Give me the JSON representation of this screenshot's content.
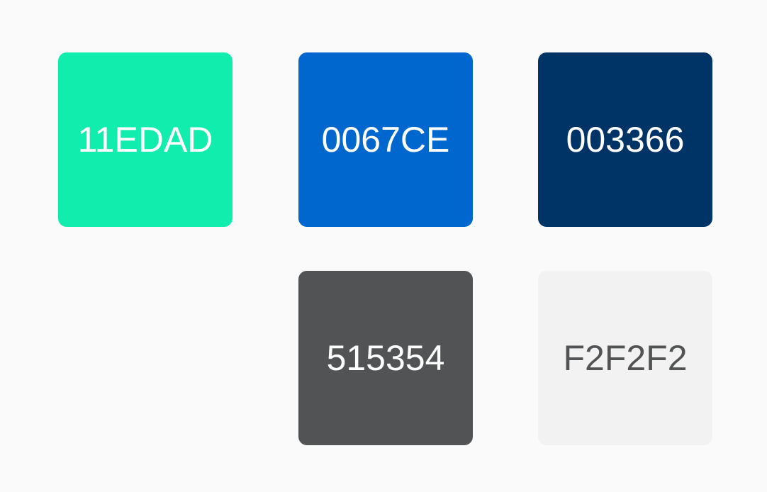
{
  "swatches": [
    {
      "label": "11EDAD",
      "color": "#11EDAD",
      "text_color": "#ffffff"
    },
    {
      "label": "0067CE",
      "color": "#0067CE",
      "text_color": "#ffffff"
    },
    {
      "label": "003366",
      "color": "#003366",
      "text_color": "#ffffff"
    },
    {
      "label": "515354",
      "color": "#515354",
      "text_color": "#ffffff"
    },
    {
      "label": "F2F2F2",
      "color": "#F2F2F2",
      "text_color": "#515354"
    }
  ]
}
